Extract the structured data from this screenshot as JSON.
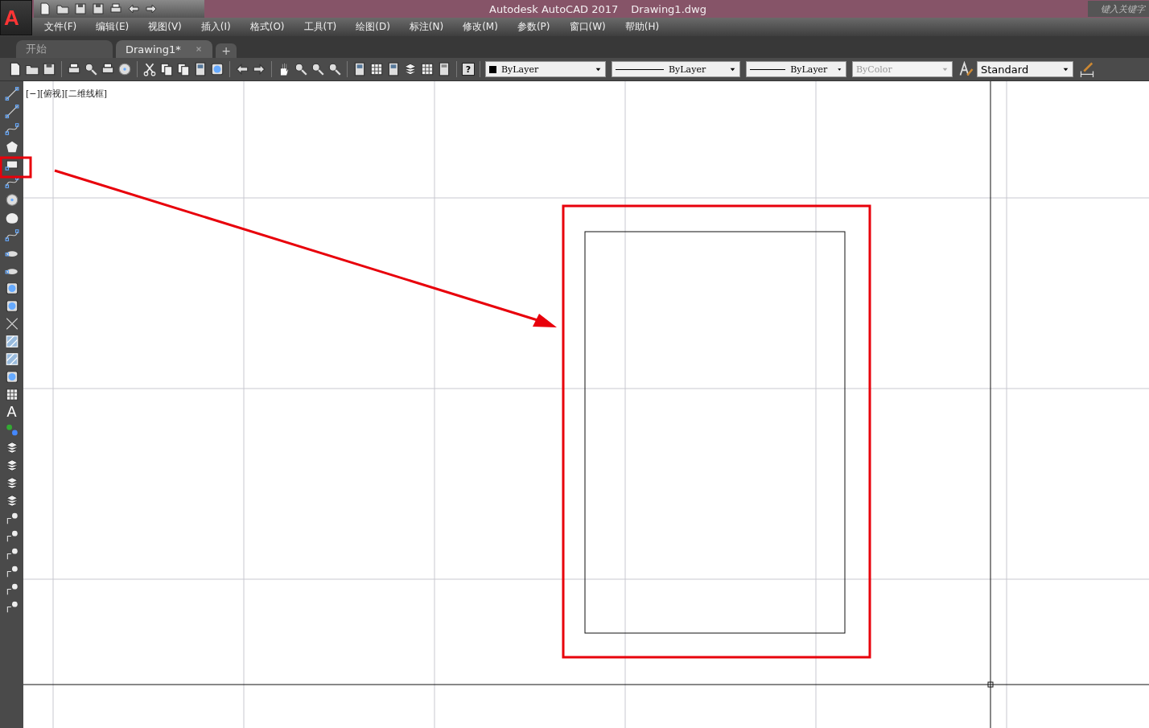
{
  "app_button": {
    "logo": "A"
  },
  "window": {
    "title": "Autodesk AutoCAD 2017",
    "document": "Drawing1.dwg"
  },
  "search": {
    "placeholder": "键入关键字"
  },
  "menu": [
    "文件(F)",
    "编辑(E)",
    "视图(V)",
    "插入(I)",
    "格式(O)",
    "工具(T)",
    "绘图(D)",
    "标注(N)",
    "修改(M)",
    "参数(P)",
    "窗口(W)",
    "帮助(H)"
  ],
  "tabs": [
    {
      "label": "开始",
      "selected": false,
      "closable": false
    },
    {
      "label": "Drawing1*",
      "selected": true,
      "closable": true
    }
  ],
  "new_tab": "+",
  "toolbar": {
    "help_glyph": "?",
    "dropdowns": [
      {
        "kind": "color",
        "value": "ByLayer",
        "disabled": false
      },
      {
        "kind": "line",
        "value": "ByLayer",
        "disabled": false
      },
      {
        "kind": "line",
        "value": "ByLayer",
        "disabled": false
      },
      {
        "kind": "plain",
        "value": "ByColor",
        "disabled": true
      },
      {
        "kind": "style",
        "value": "Standard",
        "disabled": false
      }
    ]
  },
  "draw_toolbar": {
    "text_glyph": "A"
  },
  "viewport": {
    "label": "[−][俯视][二维线框]"
  }
}
